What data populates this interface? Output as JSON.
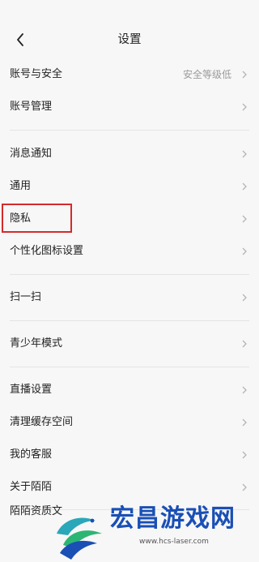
{
  "header": {
    "title": "设置"
  },
  "items": [
    {
      "label": "账号与安全",
      "value": "安全等级低"
    },
    {
      "label": "账号管理"
    },
    {
      "label": "消息通知"
    },
    {
      "label": "通用"
    },
    {
      "label": "隐私"
    },
    {
      "label": "个性化图标设置"
    },
    {
      "label": "扫一扫"
    },
    {
      "label": "青少年模式"
    },
    {
      "label": "直播设置"
    },
    {
      "label": "清理缓存空间"
    },
    {
      "label": "我的客服"
    },
    {
      "label": "关于陌陌"
    },
    {
      "label": "陌陌资质文"
    }
  ],
  "watermark": {
    "brand": "宏昌游戏网",
    "url": "www.hcs-laser.com"
  },
  "colors": {
    "highlight": "#d42a2a",
    "watermark_brand": "#1a4fb5"
  }
}
